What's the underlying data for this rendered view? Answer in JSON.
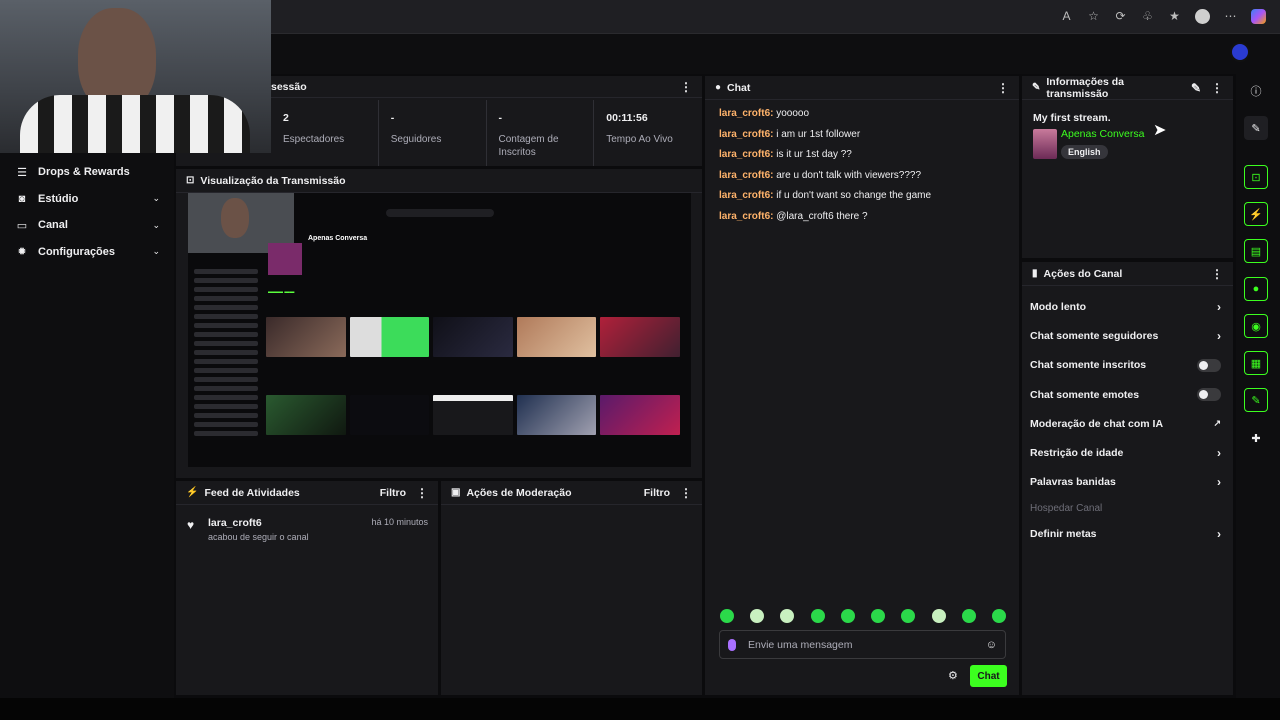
{
  "sidebar": {
    "items": [
      {
        "label": "Drops & Rewards",
        "icon": "drops-icon",
        "chevron": false
      },
      {
        "label": "Estúdio",
        "icon": "studio-icon",
        "chevron": true
      },
      {
        "label": "Canal",
        "icon": "channel-icon",
        "chevron": true
      },
      {
        "label": "Configurações",
        "icon": "gear-icon",
        "chevron": true
      }
    ]
  },
  "session": {
    "title": "sessão",
    "stats": [
      {
        "value": "2",
        "label": "Espectadores"
      },
      {
        "value": "-",
        "label": "Seguidores"
      },
      {
        "value": "-",
        "label": "Contagem de Inscritos"
      },
      {
        "value": "00:11:56",
        "label": "Tempo Ao Vivo"
      }
    ]
  },
  "preview": {
    "title": "Visualização da Transmissão",
    "channel_name": "Apenas Conversa"
  },
  "activity": {
    "title": "Feed de Atividades",
    "filter_label": "Filtro",
    "items": [
      {
        "user": "lara_croft6",
        "action": "acabou de seguir o canal",
        "time": "há 10 minutos"
      }
    ]
  },
  "moderation": {
    "title": "Ações de Moderação",
    "filter_label": "Filtro"
  },
  "chat": {
    "title": "Chat",
    "messages": [
      {
        "user": "lara_croft6:",
        "text": "yooooo"
      },
      {
        "user": "lara_croft6:",
        "text": "i am ur 1st follower"
      },
      {
        "user": "lara_croft6:",
        "text": "is it ur 1st day ??"
      },
      {
        "user": "lara_croft6:",
        "text": "are u don't talk with viewers????"
      },
      {
        "user": "lara_croft6:",
        "text": "if u don't want so change the game"
      },
      {
        "user": "lara_croft6:",
        "text": "@lara_croft6 there ?"
      }
    ],
    "input_placeholder": "Envie uma mensagem",
    "send_label": "Chat"
  },
  "stream_info": {
    "title": "Informações da transmissão",
    "stream_title": "My first stream.",
    "category": "Apenas Conversa",
    "language": "English"
  },
  "channel_actions": {
    "title": "Ações do Canal",
    "items": [
      {
        "label": "Modo lento",
        "control": "arrow"
      },
      {
        "label": "Chat somente seguidores",
        "control": "arrow"
      },
      {
        "label": "Chat somente inscritos",
        "control": "toggle",
        "value": false
      },
      {
        "label": "Chat somente emotes",
        "control": "toggle",
        "value": false
      },
      {
        "label": "Moderação de chat com IA",
        "control": "external"
      },
      {
        "label": "Restrição de idade",
        "control": "arrow"
      },
      {
        "label": "Palavras banidas",
        "control": "arrow"
      },
      {
        "label": "Hospedar Canal",
        "control": "none",
        "disabled": true
      },
      {
        "label": "Definir metas",
        "control": "arrow"
      }
    ]
  },
  "colors": {
    "accent_green": "#3cff1f",
    "chat_username": "#ffb36b",
    "panel_bg": "#18181b",
    "page_bg": "#0b0b0d"
  }
}
